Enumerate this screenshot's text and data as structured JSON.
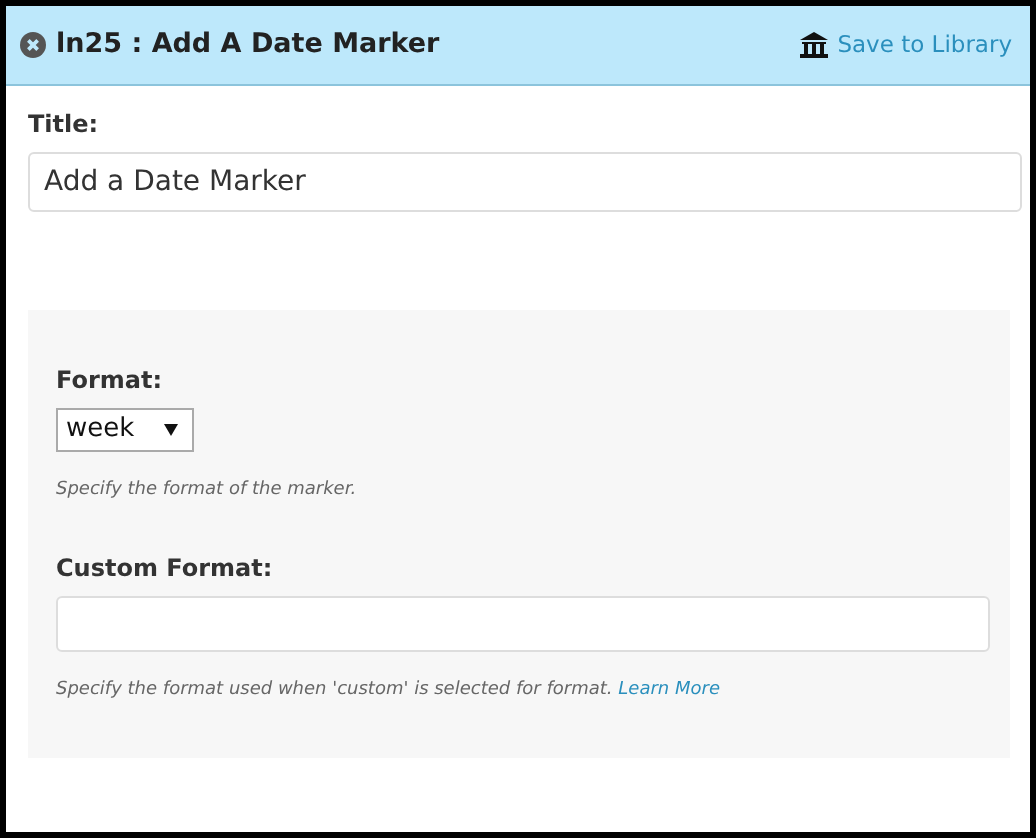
{
  "header": {
    "title": "ln25 : Add A Date Marker",
    "action": "Save to Library"
  },
  "title_field": {
    "label": "Title:",
    "value": "Add a Date Marker"
  },
  "settings": [
    {
      "kind": "select",
      "label": "Format:",
      "value": "week",
      "help": "Specify the format of the marker."
    },
    {
      "kind": "text",
      "label": "Custom Format:",
      "help": "Specify the format used when 'custom' is selected for format.",
      "link": "Learn More"
    }
  ]
}
